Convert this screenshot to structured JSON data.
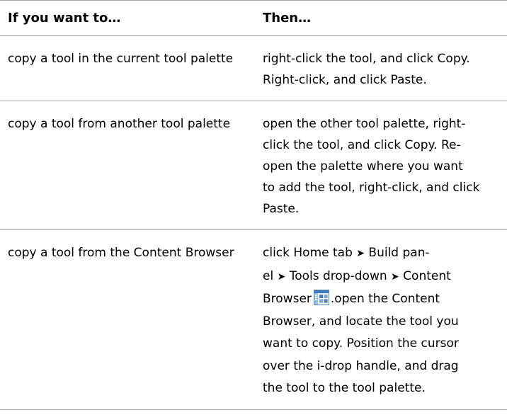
{
  "table": {
    "header": {
      "col1": "If you want to…",
      "col2": "Then…"
    },
    "rows": [
      {
        "want": "copy a tool in the current tool palette",
        "then": "right-click the tool, and click Copy. Right-click, and click Paste."
      },
      {
        "want": "copy a tool from another tool palette",
        "then_line1": "open the other tool palette, right-",
        "then_line2": "click the tool, and click Copy. Re-",
        "then_line3": "open the palette where you want",
        "then_line4": "to add the tool, right-click, and click",
        "then_line5": "Paste."
      },
      {
        "want": "copy a tool from the Content Browser",
        "then": {
          "t1": "click Home tab",
          "arrow": "➤",
          "t2": "Build pan-",
          "t3": "el",
          "t4": "Tools drop-down",
          "t5": "Content",
          "t6": "Browser",
          "icon": "content-browser-icon",
          "t7": ".open the Content",
          "t8": "Browser, and locate the tool you",
          "t9": "want to copy. Position the cursor",
          "t10": "over the i-drop handle, and drag",
          "t11": "the tool to the tool palette."
        }
      }
    ]
  }
}
